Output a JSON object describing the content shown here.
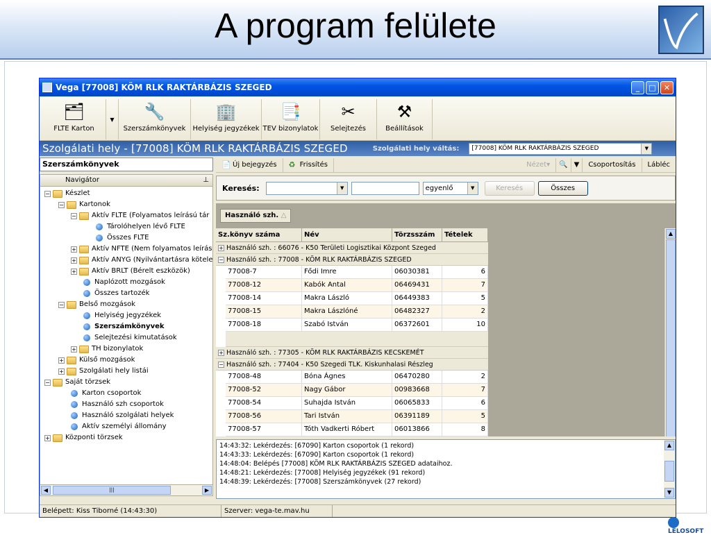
{
  "slide": {
    "title": "A program felülete",
    "footer_logo": "LELOSOFT"
  },
  "window": {
    "title": "Vega [77008] KÖM RLK RAKTÁRBÁZIS SZEGED"
  },
  "toolbar": {
    "items": [
      {
        "label": "FLTE Karton",
        "icon": "cards-icon"
      },
      {
        "label": "Szerszámkönyvek",
        "icon": "tools-book-icon"
      },
      {
        "label": "Helyiség jegyzékek",
        "icon": "building-icon"
      },
      {
        "label": "TEV bizonylatok",
        "icon": "documents-icon"
      },
      {
        "label": "Selejtezés",
        "icon": "scrap-icon"
      },
      {
        "label": "Beállítások",
        "icon": "settings-icon"
      }
    ]
  },
  "context": {
    "title": "Szolgálati hely - [77008] KÖM RLK RAKTÁRBÁZIS SZEGED",
    "switch_label": "Szolgálati hely váltás:",
    "switch_value": "[77008] KÖM RLK RAKTÁRBÁZIS SZEGED"
  },
  "left": {
    "header": "Szerszámkönyvek",
    "nav_title": "Navigátor",
    "nodes": [
      {
        "label": "Készlet"
      },
      {
        "label": "Kartonok"
      },
      {
        "label": "Aktív FLTE (Folyamatos leírású tár"
      },
      {
        "label": "Tárolóhelyen lévő FLTE"
      },
      {
        "label": "Összes FLTE"
      },
      {
        "label": "Aktív NFTE (Nem folyamatos leírás"
      },
      {
        "label": "Aktív ANYG (Nyilvántartásra kötele"
      },
      {
        "label": "Aktív BRLT (Bérelt eszközök)"
      },
      {
        "label": "Naplózott mozgások"
      },
      {
        "label": "Összes tartozék"
      },
      {
        "label": "Belső mozgások"
      },
      {
        "label": "Helyiség jegyzékek"
      },
      {
        "label": "Szerszámkönyvek"
      },
      {
        "label": "Selejtezési kimutatások"
      },
      {
        "label": "TH bizonylatok"
      },
      {
        "label": "Külső mozgások"
      },
      {
        "label": "Szolgálati hely listái"
      },
      {
        "label": "Saját törzsek"
      },
      {
        "label": "Karton csoportok"
      },
      {
        "label": "Használó szh csoportok"
      },
      {
        "label": "Használó szolgálati helyek"
      },
      {
        "label": "Aktív személyi állomány"
      },
      {
        "label": "Központi törzsek"
      }
    ]
  },
  "actions": {
    "new_entry": "Új bejegyzés",
    "refresh": "Frissítés",
    "view": "Nézet",
    "grouping": "Csoportosítás",
    "footer": "Lábléc"
  },
  "search": {
    "label": "Keresés:",
    "mode": "egyenlő",
    "search_button": "Keresés",
    "all_button": "Összes"
  },
  "grid": {
    "group_chip": "Használó szh.",
    "columns": [
      "Sz.könyv száma",
      "Név",
      "Törzsszám",
      "Tételek"
    ],
    "groups": [
      {
        "label": "Használó szh. : 66076 - K50 Területi Logisztikai Központ Szeged",
        "expanded": false,
        "rows": []
      },
      {
        "label": "Használó szh. : 77008 - KÖM RLK RAKTÁRBÁZIS SZEGED",
        "expanded": true,
        "rows": [
          [
            "77008-7",
            "Fődi Imre",
            "06030381",
            "6"
          ],
          [
            "77008-12",
            "Kabók Antal",
            "06469431",
            "7"
          ],
          [
            "77008-14",
            "Makra László",
            "06449383",
            "5"
          ],
          [
            "77008-15",
            "Makra Lászlóné",
            "06482327",
            "2"
          ],
          [
            "77008-18",
            "Szabó István",
            "06372601",
            "10"
          ]
        ]
      },
      {
        "label": "Használó szh. : 77305 - KÖM RLK RAKTÁRBÁZIS KECSKEMÉT",
        "expanded": false,
        "rows": []
      },
      {
        "label": "Használó szh. : 77404 - K50 Szegedi TLK. Kiskunhalasi Részleg",
        "expanded": true,
        "rows": [
          [
            "77008-48",
            "Bóna Ágnes",
            "06470280",
            "2"
          ],
          [
            "77008-52",
            "Nagy Gábor",
            "00983668",
            "7"
          ],
          [
            "77008-54",
            "Suhajda István",
            "06065833",
            "6"
          ],
          [
            "77008-56",
            "Tari István",
            "06391189",
            "5"
          ],
          [
            "77008-57",
            "Tóth Vadkerti Róbert",
            "06013866",
            "8"
          ]
        ]
      }
    ]
  },
  "log": {
    "lines": [
      "14:43:32: Lekérdezés: [67090] Karton csoportok (1 rekord)",
      "14:43:33: Lekérdezés: [67090] Karton csoportok (1 rekord)",
      "14:48:04: Belépés [77008] KÖM RLK RAKTÁRBÁZIS SZEGED adataihoz.",
      "14:48:21: Lekérdezés: [77008] Helyiség jegyzékek (91 rekord)",
      "14:48:39: Lekérdezés: [77008] Szerszámkönyvek (27 rekord)"
    ]
  },
  "status": {
    "user": "Belépett: Kiss Tiborné (14:43:30)",
    "server": "Szerver: vega-te.mav.hu"
  }
}
